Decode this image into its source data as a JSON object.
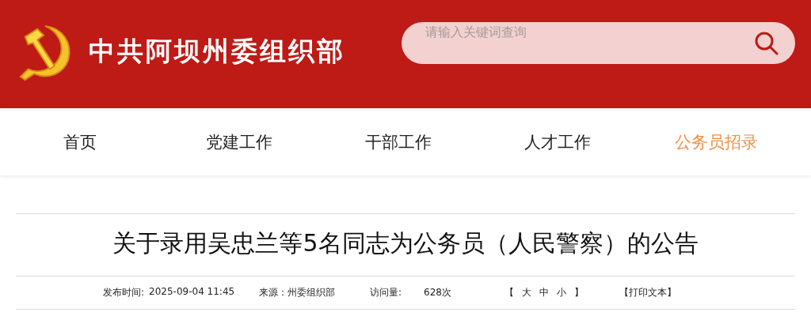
{
  "header": {
    "site_title": "中共阿坝州委组织部",
    "search": {
      "placeholder": "请输入关键词查询"
    }
  },
  "nav": [
    {
      "label": "首页",
      "selected": false
    },
    {
      "label": "党建工作",
      "selected": false
    },
    {
      "label": "干部工作",
      "selected": false
    },
    {
      "label": "人才工作",
      "selected": false
    },
    {
      "label": "公务员招录",
      "selected": true
    }
  ],
  "article": {
    "title": "关于录用吴忠兰等5名同志为公务员（人民警察）的公告",
    "meta": {
      "publish_label": "发布时间:",
      "publish_time": "2025-09-04 11:45",
      "source": "来源：州委组织部",
      "views_label": "访问量:",
      "views": "628次",
      "size_open": "【",
      "sizes": [
        "大",
        "中",
        "小"
      ],
      "size_close": "】",
      "print": "【打印文本】"
    }
  }
}
